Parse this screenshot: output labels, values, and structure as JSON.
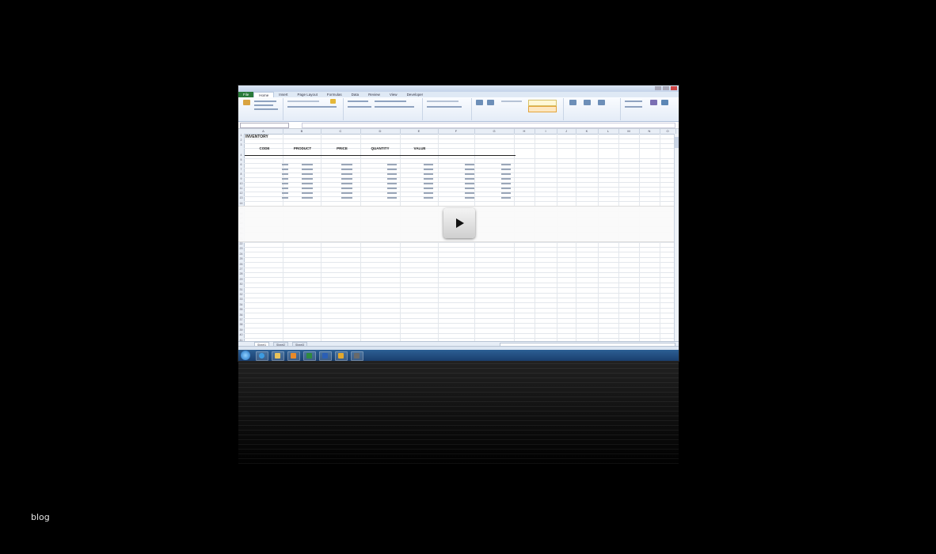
{
  "excel": {
    "tabs": [
      "File",
      "Home",
      "Insert",
      "Page Layout",
      "Formulas",
      "Data",
      "Review",
      "View",
      "Developer"
    ],
    "active_tab": "Home",
    "sheet_title": "INVENTORY",
    "table_headers": [
      "CODE",
      "PRODUCT",
      "PRICE",
      "QUANTITY",
      "VALUE"
    ],
    "sheet_tabs": [
      "Sheet1",
      "Sheet2",
      "Sheet3"
    ]
  },
  "page": {
    "caption": "blog"
  }
}
